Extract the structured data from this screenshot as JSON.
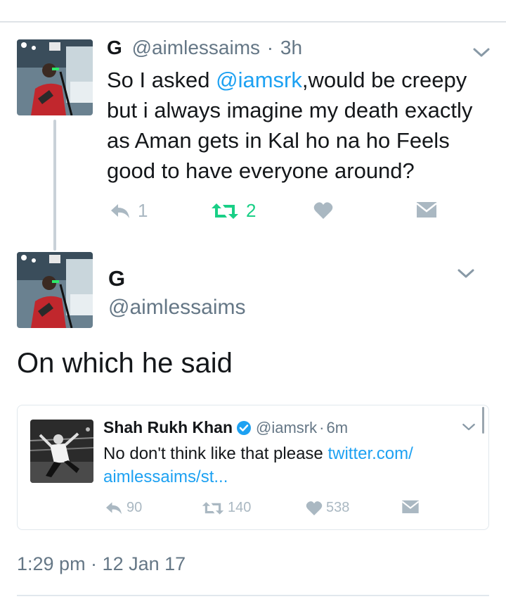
{
  "tweet": {
    "name": "G",
    "handle": "@aimlessaims",
    "time": "3h",
    "text_before": "So I asked ",
    "mention": "@iamsrk",
    "text_after": ",would be creepy but i always imagine my death exactly as Aman gets in Kal ho na ho Feels good to have everyone around?",
    "reply_count": "1",
    "retweet_count": "2"
  },
  "detail": {
    "name": "G",
    "handle": "@aimlessaims",
    "text": "On which he said",
    "timestamp": "1:29 pm · 12 Jan 17"
  },
  "quoted": {
    "name": "Shah Rukh Khan",
    "handle": "@iamsrk",
    "time": "6m",
    "text": "No don't think like that please ",
    "link": "twitter.com/ aimlessaims/st...",
    "reply_count": "90",
    "retweet_count": "140",
    "like_count": "538"
  },
  "colors": {
    "link": "#1da1f2",
    "retweet_active": "#19cf86",
    "muted": "#aab8c2",
    "secondary_text": "#657786"
  },
  "icons": [
    "reply-icon",
    "retweet-icon",
    "like-icon",
    "dm-icon",
    "chevron-down-icon",
    "verified-icon"
  ]
}
